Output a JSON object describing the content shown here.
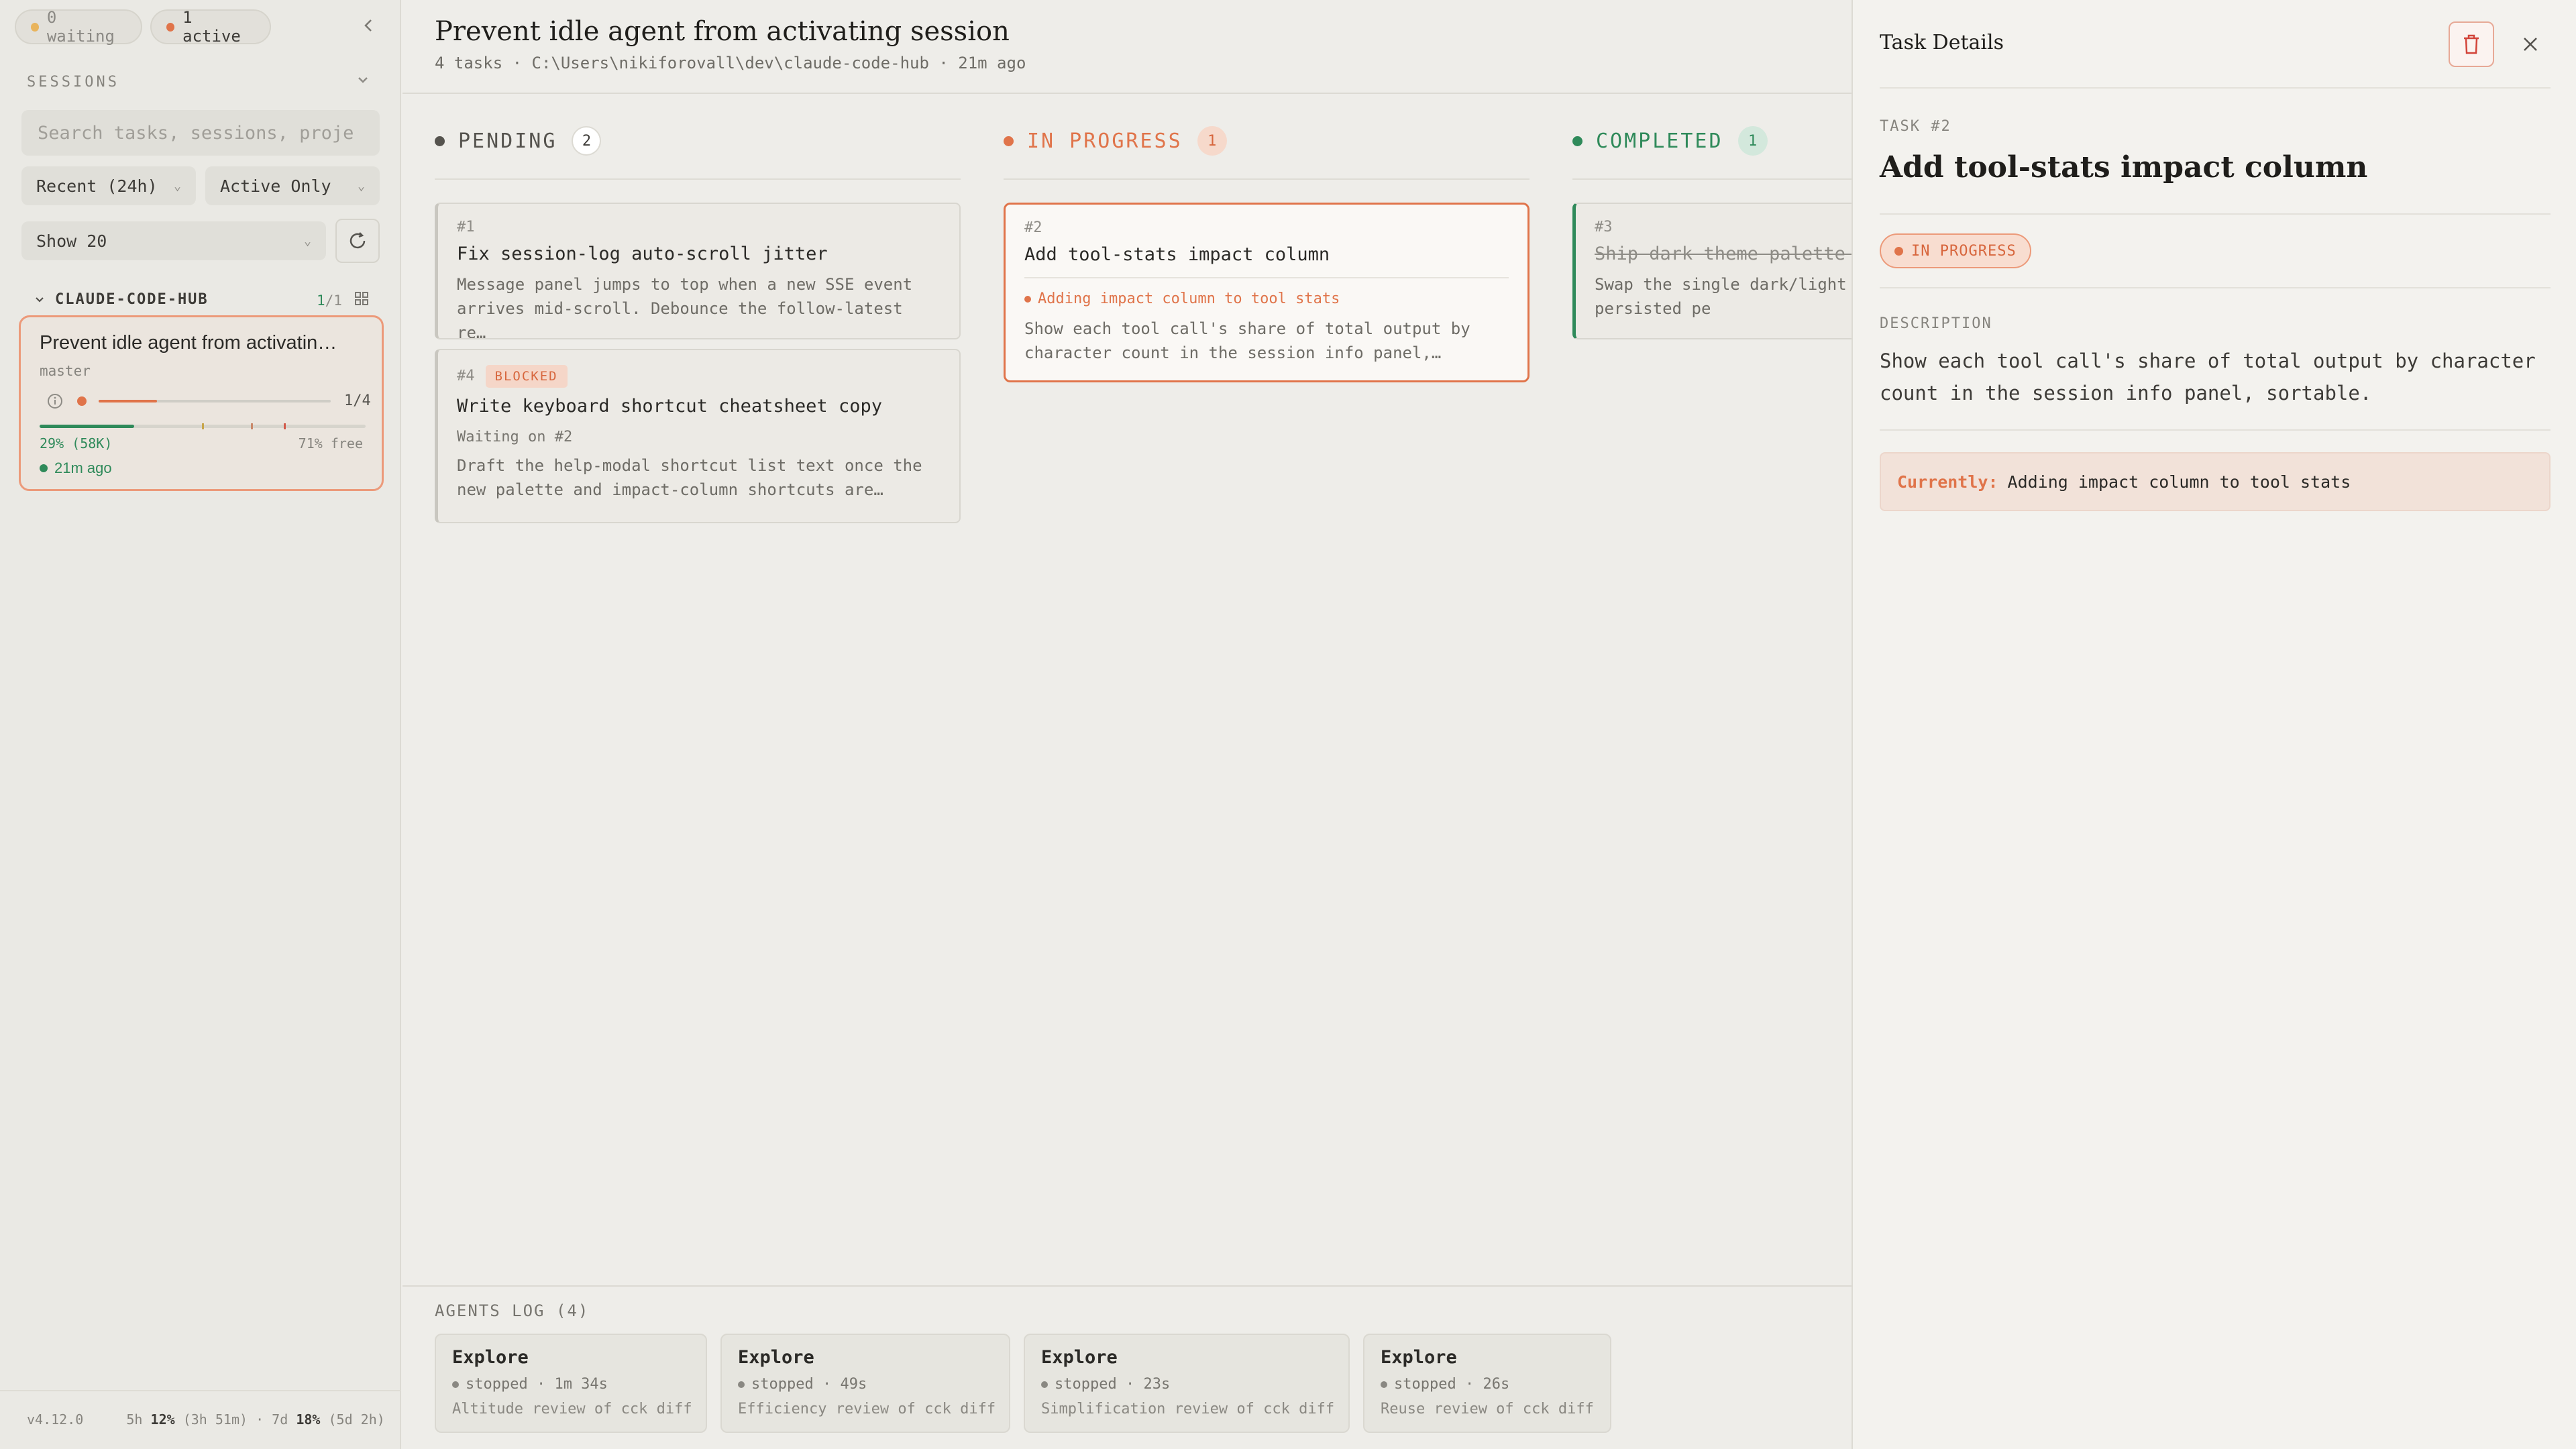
{
  "sidebar": {
    "status": {
      "waiting": "0 waiting",
      "active": "1 active"
    },
    "sessions_label": "SESSIONS",
    "search_placeholder": "Search tasks, sessions, proje",
    "filters": {
      "recent": "Recent (24h)",
      "active_only": "Active Only",
      "show": "Show 20"
    },
    "project": {
      "name": "CLAUDE-CODE-HUB",
      "count_active": "1",
      "count_total": "/1"
    },
    "session": {
      "title": "Prevent idle agent from activatin…",
      "branch": "master",
      "progress": "1/4",
      "progress_fraction": 0.25,
      "context_used": "29% (58K)",
      "context_used_fraction": 0.29,
      "context_free": "71% free",
      "time": "21m ago"
    },
    "footer": {
      "version": "v4.12.0",
      "usage_5h_label": "5h",
      "usage_5h_pct": "12%",
      "usage_5h_reset": "(3h 51m)",
      "sep": "·",
      "usage_7d_label": "7d",
      "usage_7d_pct": "18%",
      "usage_7d_reset": "(5d 2h)"
    }
  },
  "header": {
    "title": "Prevent idle agent from activating session",
    "meta": "4 tasks · C:\\Users\\nikiforovall\\dev\\claude-code-hub · 21m ago"
  },
  "columns": {
    "pending": {
      "label": "PENDING",
      "count": "2",
      "cards": [
        {
          "num": "#1",
          "title": "Fix session-log auto-scroll jitter",
          "desc": "Message panel jumps to top when a new SSE event arrives mid-scroll. Debounce the follow-latest re…"
        },
        {
          "num": "#4",
          "badge": "BLOCKED",
          "title": "Write keyboard shortcut cheatsheet copy",
          "waiting": "Waiting on #2",
          "desc": "Draft the help-modal shortcut list text once the new palette and impact-column shortcuts are…"
        }
      ]
    },
    "in_progress": {
      "label": "IN PROGRESS",
      "count": "1",
      "cards": [
        {
          "num": "#2",
          "title": "Add tool-stats impact column",
          "active": "Adding impact column to tool stats",
          "desc": "Show each tool call's share of total output by character count in the session info panel,…"
        }
      ]
    },
    "completed": {
      "label": "COMPLETED",
      "count": "1",
      "cards": [
        {
          "num": "#3",
          "title": "Ship dark theme palette p",
          "desc": "Swap the single dark/light accent themes, persisted pe"
        }
      ]
    }
  },
  "agents_log": {
    "label": "AGENTS LOG (4)",
    "agents": [
      {
        "name": "Explore",
        "state": "stopped · 1m 34s",
        "task": "Altitude review of cck diff"
      },
      {
        "name": "Explore",
        "state": "stopped · 49s",
        "task": "Efficiency review of cck diff"
      },
      {
        "name": "Explore",
        "state": "stopped · 23s",
        "task": "Simplification review of cck diff"
      },
      {
        "name": "Explore",
        "state": "stopped · 26s",
        "task": "Reuse review of cck diff"
      }
    ]
  },
  "details": {
    "heading": "Task Details",
    "task_label": "TASK #2",
    "title": "Add tool-stats impact column",
    "status": "IN PROGRESS",
    "description_label": "DESCRIPTION",
    "description": "Show each tool call's share of total output by character count in the session info panel, sortable.",
    "currently_label": "Currently:",
    "currently_value": "Adding impact column to tool stats"
  },
  "colors": {
    "accent": "#e0744a",
    "completed": "#2f8a5a",
    "pending": "#55534e"
  }
}
